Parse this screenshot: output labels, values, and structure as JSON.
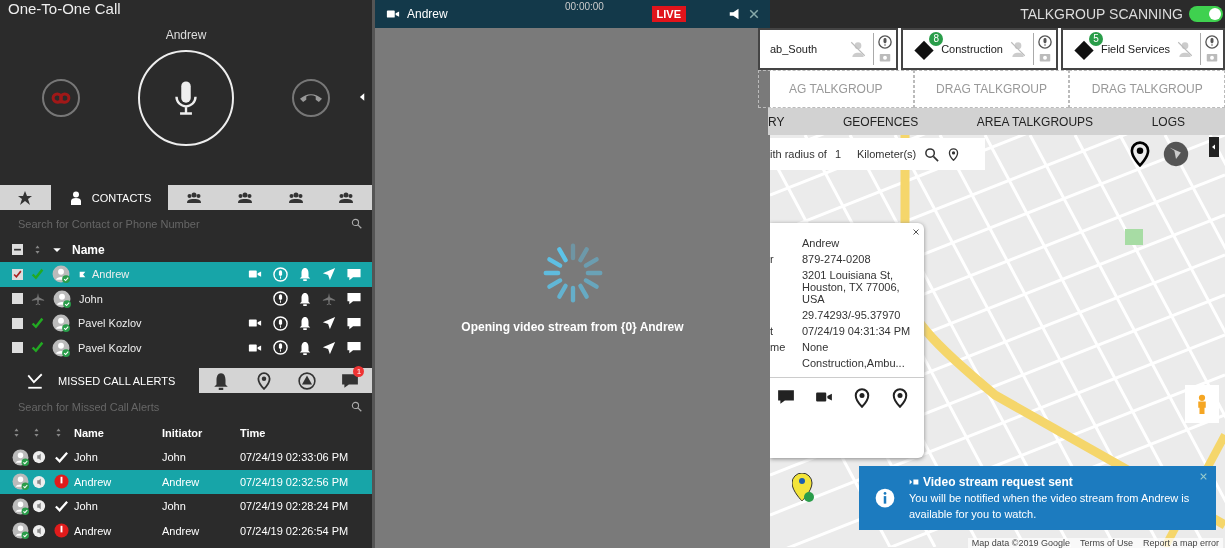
{
  "call": {
    "title": "One-To-One Call",
    "callee": "Andrew",
    "muted": false
  },
  "contacts": {
    "tabs": [
      {
        "kind": "star",
        "selected": false
      },
      {
        "kind": "person",
        "label": "CONTACTS",
        "selected": true
      },
      {
        "kind": "group",
        "selected": false
      },
      {
        "kind": "group",
        "selected": false
      },
      {
        "kind": "group",
        "selected": false
      },
      {
        "kind": "group",
        "selected": false
      }
    ],
    "search": {
      "placeholder": "Search for Contact or Phone Number"
    },
    "name_column": "Name",
    "rows": [
      {
        "name": "Andrew",
        "selected": true,
        "checked": true,
        "flagged": true,
        "airplane": false,
        "video": true
      },
      {
        "name": "John",
        "selected": false,
        "checked": false,
        "flagged": false,
        "airplane": true,
        "video": false
      },
      {
        "name": "Pavel Kozlov",
        "selected": false,
        "checked": false,
        "flagged": false,
        "airplane": false,
        "video": true
      },
      {
        "name": "Pavel Kozlov",
        "selected": false,
        "checked": false,
        "flagged": false,
        "airplane": false,
        "video": true
      }
    ]
  },
  "missed_alerts": {
    "tabs": [
      {
        "kind": "missed",
        "label": "MISSED CALL ALERTS",
        "selected": true
      },
      {
        "kind": "bell",
        "selected": false
      },
      {
        "kind": "pin",
        "selected": false
      },
      {
        "kind": "warning",
        "selected": false
      },
      {
        "kind": "chat",
        "badge": "1",
        "selected": false
      }
    ],
    "search": {
      "placeholder": "Search for Missed Call Alerts"
    },
    "columns": [
      "Name",
      "Initiator",
      "Time"
    ],
    "rows": [
      {
        "name": "John",
        "initiator": "John",
        "time": "07/24/19 02:33:06 PM",
        "answered": true,
        "selected": false
      },
      {
        "name": "Andrew",
        "initiator": "Andrew",
        "time": "07/24/19 02:32:56 PM",
        "answered": false,
        "selected": true
      },
      {
        "name": "John",
        "initiator": "John",
        "time": "07/24/19 02:28:24 PM",
        "answered": true,
        "selected": false
      },
      {
        "name": "Andrew",
        "initiator": "Andrew",
        "time": "07/24/19 02:26:54 PM",
        "answered": false,
        "selected": false
      }
    ]
  },
  "video": {
    "title": "Andrew",
    "timer": "00:00:00",
    "live": "LIVE",
    "message": "Opening video stream from {0} Andrew"
  },
  "talkgroups": {
    "scanning_label": "TALKGROUP SCANNING",
    "scanning_on": true,
    "groups": [
      {
        "name": "ab_South"
      },
      {
        "name": "Construction",
        "count": "8"
      },
      {
        "name": "Field Services",
        "count": "5"
      }
    ],
    "drop_slots": [
      "AG TALKGROUP",
      "DRAG TALKGROUP",
      "DRAG TALKGROUP"
    ]
  },
  "nav_tabs": [
    "RY",
    "GEOFENCES",
    "AREA TALKGROUPS",
    "LOGS"
  ],
  "map": {
    "search": {
      "prefix": "ith radius of",
      "radius": "1",
      "unit": "Kilometer(s)"
    },
    "popup": {
      "fields": [
        {
          "value": "Andrew"
        },
        {
          "label": "r",
          "value": "879-274-0208"
        },
        {
          "value": "3201 Louisiana St, Houston, TX 77006, USA"
        },
        {
          "value": "29.74293/-95.37970"
        },
        {
          "label": "t",
          "value": "07/24/19 04:31:34 PM"
        },
        {
          "label": "me",
          "value": "None"
        },
        {
          "value": "Construction,Ambu..."
        }
      ]
    },
    "toast": {
      "title": "Video stream request sent",
      "message": "You will be notified when the video stream from Andrew is available for you to watch."
    },
    "attribution": [
      "Map data ©2019 Google",
      "Terms of Use",
      "Report a map error"
    ]
  }
}
